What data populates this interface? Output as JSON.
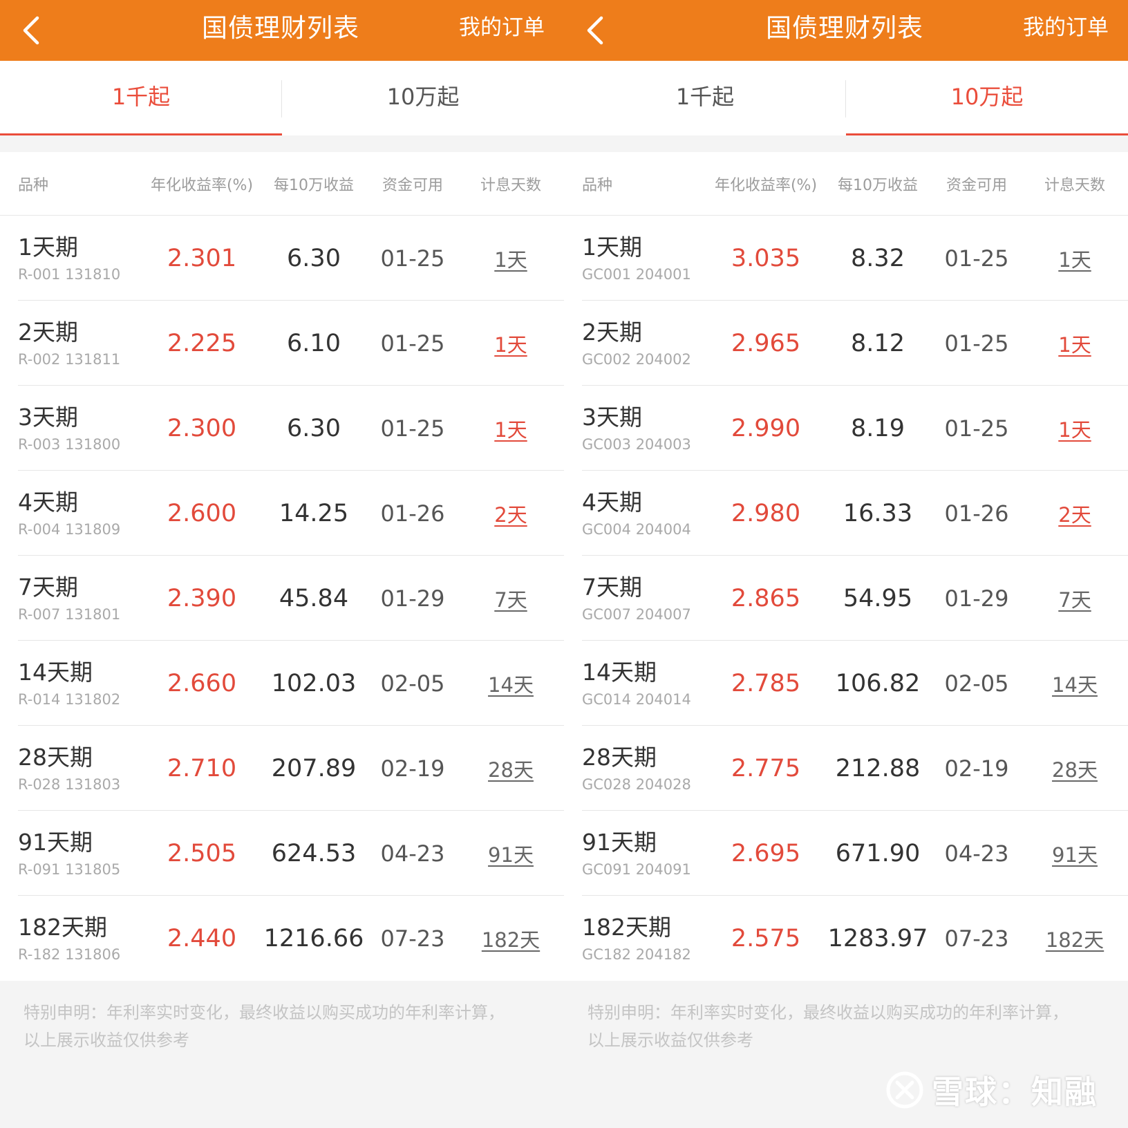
{
  "screens": [
    {
      "header": {
        "title": "国债理财列表",
        "order_link": "我的订单"
      },
      "tabs": [
        {
          "label": "1千起"
        },
        {
          "label": "10万起"
        }
      ],
      "active_tab": 0,
      "columns": {
        "variety": "品种",
        "rate": "年化收益率(%)",
        "earn": "每10万收益",
        "avail": "资金可用",
        "days": "计息天数"
      },
      "rows": [
        {
          "name": "1天期",
          "code": "R-001 131810",
          "rate": "2.301",
          "earn": "6.30",
          "avail": "01-25",
          "days": "1天",
          "days_color": "gray"
        },
        {
          "name": "2天期",
          "code": "R-002 131811",
          "rate": "2.225",
          "earn": "6.10",
          "avail": "01-25",
          "days": "1天",
          "days_color": "red"
        },
        {
          "name": "3天期",
          "code": "R-003 131800",
          "rate": "2.300",
          "earn": "6.30",
          "avail": "01-25",
          "days": "1天",
          "days_color": "red"
        },
        {
          "name": "4天期",
          "code": "R-004 131809",
          "rate": "2.600",
          "earn": "14.25",
          "avail": "01-26",
          "days": "2天",
          "days_color": "red"
        },
        {
          "name": "7天期",
          "code": "R-007 131801",
          "rate": "2.390",
          "earn": "45.84",
          "avail": "01-29",
          "days": "7天",
          "days_color": "gray"
        },
        {
          "name": "14天期",
          "code": "R-014 131802",
          "rate": "2.660",
          "earn": "102.03",
          "avail": "02-05",
          "days": "14天",
          "days_color": "gray"
        },
        {
          "name": "28天期",
          "code": "R-028 131803",
          "rate": "2.710",
          "earn": "207.89",
          "avail": "02-19",
          "days": "28天",
          "days_color": "gray"
        },
        {
          "name": "91天期",
          "code": "R-091 131805",
          "rate": "2.505",
          "earn": "624.53",
          "avail": "04-23",
          "days": "91天",
          "days_color": "gray"
        },
        {
          "name": "182天期",
          "code": "R-182 131806",
          "rate": "2.440",
          "earn": "1216.66",
          "avail": "07-23",
          "days": "182天",
          "days_color": "gray"
        }
      ],
      "footer": {
        "line1": "特别申明：年利率实时变化，最终收益以购买成功的年利率计算，",
        "line2": "以上展示收益仅供参考"
      }
    },
    {
      "header": {
        "title": "国债理财列表",
        "order_link": "我的订单"
      },
      "tabs": [
        {
          "label": "1千起"
        },
        {
          "label": "10万起"
        }
      ],
      "active_tab": 1,
      "columns": {
        "variety": "品种",
        "rate": "年化收益率(%)",
        "earn": "每10万收益",
        "avail": "资金可用",
        "days": "计息天数"
      },
      "rows": [
        {
          "name": "1天期",
          "code": "GC001 204001",
          "rate": "3.035",
          "earn": "8.32",
          "avail": "01-25",
          "days": "1天",
          "days_color": "gray"
        },
        {
          "name": "2天期",
          "code": "GC002 204002",
          "rate": "2.965",
          "earn": "8.12",
          "avail": "01-25",
          "days": "1天",
          "days_color": "red"
        },
        {
          "name": "3天期",
          "code": "GC003 204003",
          "rate": "2.990",
          "earn": "8.19",
          "avail": "01-25",
          "days": "1天",
          "days_color": "red"
        },
        {
          "name": "4天期",
          "code": "GC004 204004",
          "rate": "2.980",
          "earn": "16.33",
          "avail": "01-26",
          "days": "2天",
          "days_color": "red"
        },
        {
          "name": "7天期",
          "code": "GC007 204007",
          "rate": "2.865",
          "earn": "54.95",
          "avail": "01-29",
          "days": "7天",
          "days_color": "gray"
        },
        {
          "name": "14天期",
          "code": "GC014 204014",
          "rate": "2.785",
          "earn": "106.82",
          "avail": "02-05",
          "days": "14天",
          "days_color": "gray"
        },
        {
          "name": "28天期",
          "code": "GC028 204028",
          "rate": "2.775",
          "earn": "212.88",
          "avail": "02-19",
          "days": "28天",
          "days_color": "gray"
        },
        {
          "name": "91天期",
          "code": "GC091 204091",
          "rate": "2.695",
          "earn": "671.90",
          "avail": "04-23",
          "days": "91天",
          "days_color": "gray"
        },
        {
          "name": "182天期",
          "code": "GC182 204182",
          "rate": "2.575",
          "earn": "1283.97",
          "avail": "07-23",
          "days": "182天",
          "days_color": "gray"
        }
      ],
      "footer": {
        "line1": "特别申明：年利率实时变化，最终收益以购买成功的年利率计算，",
        "line2": "以上展示收益仅供参考"
      }
    }
  ],
  "watermark": "雪球：知融",
  "colors": {
    "header_bg": "#ee7d1b",
    "accent_red": "#e24a3b",
    "tab_active": "#ea4d3b"
  },
  "icons": {
    "back": "chevron-left-icon",
    "watermark_logo": "snowball-logo-icon"
  }
}
